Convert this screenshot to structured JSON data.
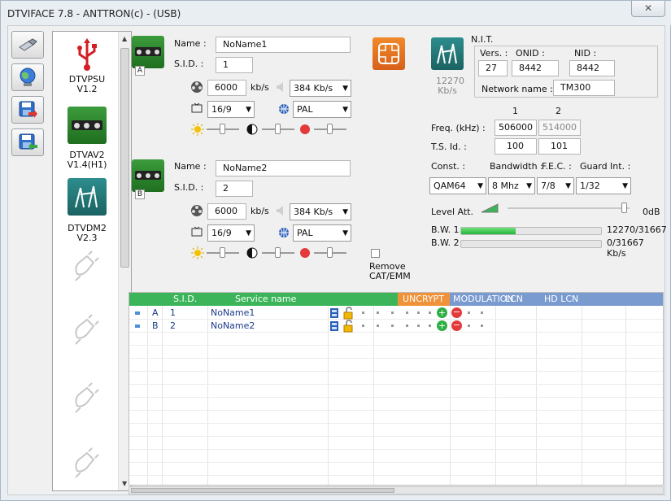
{
  "window": {
    "title": "DTVIFACE 7.8 - ANTTRON(c) - (USB)",
    "close_glyph": "✕"
  },
  "toolbar": {
    "buttons": [
      {
        "icon": "usb-plug-icon"
      },
      {
        "icon": "globe-network-icon"
      },
      {
        "icon": "save-export-icon"
      },
      {
        "icon": "save-import-icon"
      }
    ]
  },
  "devices": [
    {
      "name": "DTVPSU",
      "version": "V1.2",
      "icon": "usb-trident-icon"
    },
    {
      "name": "DTVAV2",
      "version": "V1.4(H1)",
      "icon": "av-module-icon"
    },
    {
      "name": "DTVDM2",
      "version": "V2.3",
      "icon": "antenna-module-icon"
    }
  ],
  "services": [
    {
      "tag": "A",
      "name_label": "Name :",
      "name_value": "NoName1",
      "sid_label": "S.I.D. :",
      "sid_value": "1",
      "video_bitrate": "6000",
      "video_unit": "kb/s",
      "audio_bitrate": "384 Kb/s",
      "aspect": "16/9",
      "standard": "PAL"
    },
    {
      "tag": "B",
      "name_label": "Name :",
      "name_value": "NoName2",
      "sid_label": "S.I.D. :",
      "sid_value": "2",
      "video_bitrate": "6000",
      "video_unit": "kb/s",
      "audio_bitrate": "384 Kb/s",
      "aspect": "16/9",
      "standard": "PAL"
    }
  ],
  "remove_cat": "Remove CAT/EMM",
  "nit": {
    "title": "N.I.T.",
    "vers_label": "Vers. :",
    "onid_label": "ONID :",
    "nid_label": "NID :",
    "vers": "27",
    "onid": "8442",
    "nid": "8442",
    "network_label": "Network name :",
    "network_name": "TM300",
    "bitrate_value": "12270",
    "bitrate_unit": "Kb/s"
  },
  "channels": {
    "col1": "1",
    "col2": "2",
    "freq_label": "Freq. (kHz) :",
    "freq1": "506000",
    "freq2": "514000",
    "ts_label": "T.S. Id. :",
    "ts1": "100",
    "ts2": "101",
    "const_label": "Const. :",
    "bw_label": "Bandwidth :",
    "fec_label": "F.E.C. :",
    "guard_label": "Guard Int. :",
    "const": "QAM64",
    "bandwidth": "8 Mhz",
    "fec": "7/8",
    "guard": "1/32",
    "level_label": "Level Att.",
    "level_value": "0dB",
    "bw1_label": "B.W. 1",
    "bw1_value": "12270/31667",
    "bw1_fraction": 0.387,
    "bw2_label": "B.W. 2",
    "bw2_value": "0/31667 Kb/s",
    "bw2_fraction": 0
  },
  "table": {
    "headers": {
      "sid": "S.I.D.",
      "service_name": "Service name",
      "uncrypt": "UNCRYPT",
      "modulation": "MODULATION",
      "lcn": "LCN",
      "hd_lcn": "HD LCN"
    },
    "colors": {
      "green": "#3cb55a",
      "orange": "#f0923a",
      "blue": "#7a9bcf"
    },
    "rows": [
      {
        "tag": "A",
        "sid": "1",
        "name": "NoName1"
      },
      {
        "tag": "B",
        "sid": "2",
        "name": "NoName2"
      }
    ]
  }
}
